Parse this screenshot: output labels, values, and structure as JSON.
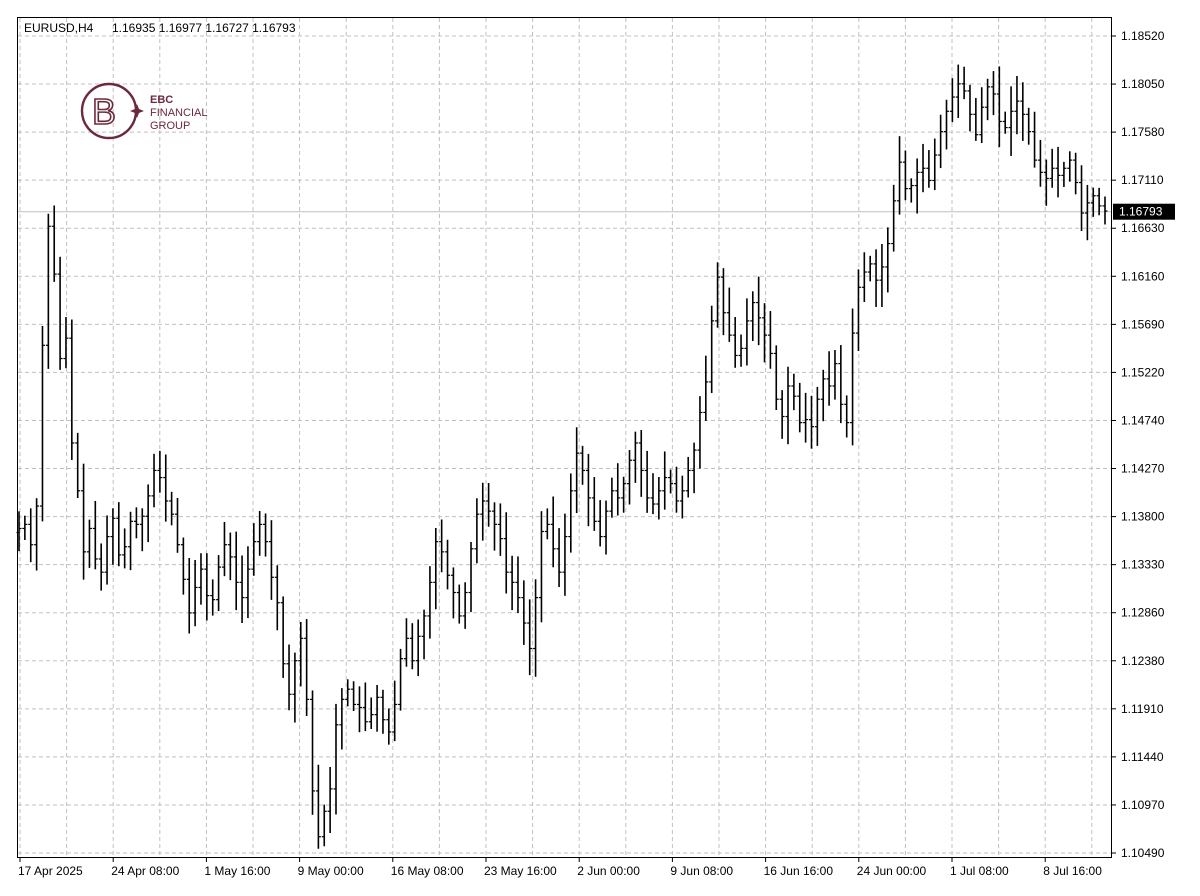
{
  "header": {
    "symbol_label": "EURUSD,H4",
    "ohlc_label": "1.16935 1.16977 1.16727 1.16793"
  },
  "logo": {
    "line1": "EBC",
    "line2": "FINANCIAL",
    "line3": "GROUP",
    "color": "#6b2a3c"
  },
  "colors": {
    "bars": "#000000",
    "grid": "#c0c0c0",
    "price_line": "#c0c0c0",
    "price_tag_bg": "#000000",
    "price_tag_text": "#ffffff",
    "background": "#ffffff"
  },
  "chart_data": {
    "type": "ohlc",
    "title": "",
    "xlabel": "",
    "ylabel": "",
    "ylim": [
      1.1049,
      1.1852
    ],
    "y_ticks": [
      "1.18520",
      "1.18050",
      "1.17580",
      "1.17110",
      "1.16630",
      "1.16160",
      "1.15690",
      "1.15220",
      "1.14740",
      "1.14270",
      "1.13800",
      "1.13330",
      "1.12860",
      "1.12380",
      "1.11910",
      "1.11440",
      "1.10970",
      "1.10490"
    ],
    "x_ticks": [
      "17 Apr 2025",
      "24 Apr 08:00",
      "1 May 16:00",
      "9 May 00:00",
      "16 May 08:00",
      "23 May 16:00",
      "2 Jun 00:00",
      "9 Jun 08:00",
      "16 Jun 16:00",
      "24 Jun 00:00",
      "1 Jul 08:00",
      "8 Jul 16:00"
    ],
    "grid": true,
    "current_price": "1.16793",
    "close_path": [
      1.1368,
      1.1372,
      1.1352,
      1.139,
      1.1548,
      1.1665,
      1.1618,
      1.1535,
      1.1555,
      1.1452,
      1.1405,
      1.1345,
      1.1368,
      1.1338,
      1.1325,
      1.136,
      1.1378,
      1.1342,
      1.135,
      1.1375,
      1.1372,
      1.138,
      1.14,
      1.1425,
      1.1418,
      1.1395,
      1.1382,
      1.1352,
      1.1318,
      1.1285,
      1.131,
      1.1328,
      1.1302,
      1.1298,
      1.133,
      1.1352,
      1.134,
      1.1315,
      1.13,
      1.1328,
      1.1355,
      1.1372,
      1.1355,
      1.132,
      1.1295,
      1.1235,
      1.1205,
      1.1238,
      1.126,
      1.12,
      1.111,
      1.1065,
      1.109,
      1.1112,
      1.1175,
      1.12,
      1.121,
      1.1195,
      1.1192,
      1.1178,
      1.1185,
      1.1202,
      1.118,
      1.1168,
      1.1195,
      1.124,
      1.126,
      1.1238,
      1.1262,
      1.1282,
      1.1315,
      1.1355,
      1.1345,
      1.1322,
      1.1305,
      1.1282,
      1.1305,
      1.1348,
      1.1382,
      1.1395,
      1.1385,
      1.1372,
      1.1358,
      1.1325,
      1.1315,
      1.13,
      1.1275,
      1.125,
      1.13,
      1.1365,
      1.1372,
      1.1348,
      1.1325,
      1.136,
      1.1405,
      1.1442,
      1.1425,
      1.1398,
      1.1375,
      1.136,
      1.1385,
      1.1405,
      1.1398,
      1.1412,
      1.1435,
      1.1452,
      1.1425,
      1.1398,
      1.1392,
      1.1405,
      1.1418,
      1.1412,
      1.1395,
      1.1405,
      1.1425,
      1.1445,
      1.1482,
      1.1512,
      1.1572,
      1.1615,
      1.158,
      1.1558,
      1.1538,
      1.1545,
      1.1572,
      1.159,
      1.1575,
      1.1558,
      1.154,
      1.1495,
      1.1478,
      1.1508,
      1.1498,
      1.1472,
      1.1475,
      1.1468,
      1.1495,
      1.1515,
      1.1508,
      1.153,
      1.149,
      1.1472,
      1.156,
      1.1605,
      1.162,
      1.1628,
      1.1612,
      1.1625,
      1.1648,
      1.169,
      1.1728,
      1.1702,
      1.1705,
      1.1718,
      1.1722,
      1.171,
      1.1735,
      1.1758,
      1.1778,
      1.1792,
      1.1805,
      1.1798,
      1.1775,
      1.1755,
      1.1782,
      1.1802,
      1.1795,
      1.1768,
      1.1762,
      1.1778,
      1.1788,
      1.1775,
      1.1758,
      1.173,
      1.1718,
      1.1712,
      1.1722,
      1.1715,
      1.1722,
      1.173,
      1.1708,
      1.1678,
      1.1688,
      1.1695,
      1.1685,
      1.168
    ]
  }
}
